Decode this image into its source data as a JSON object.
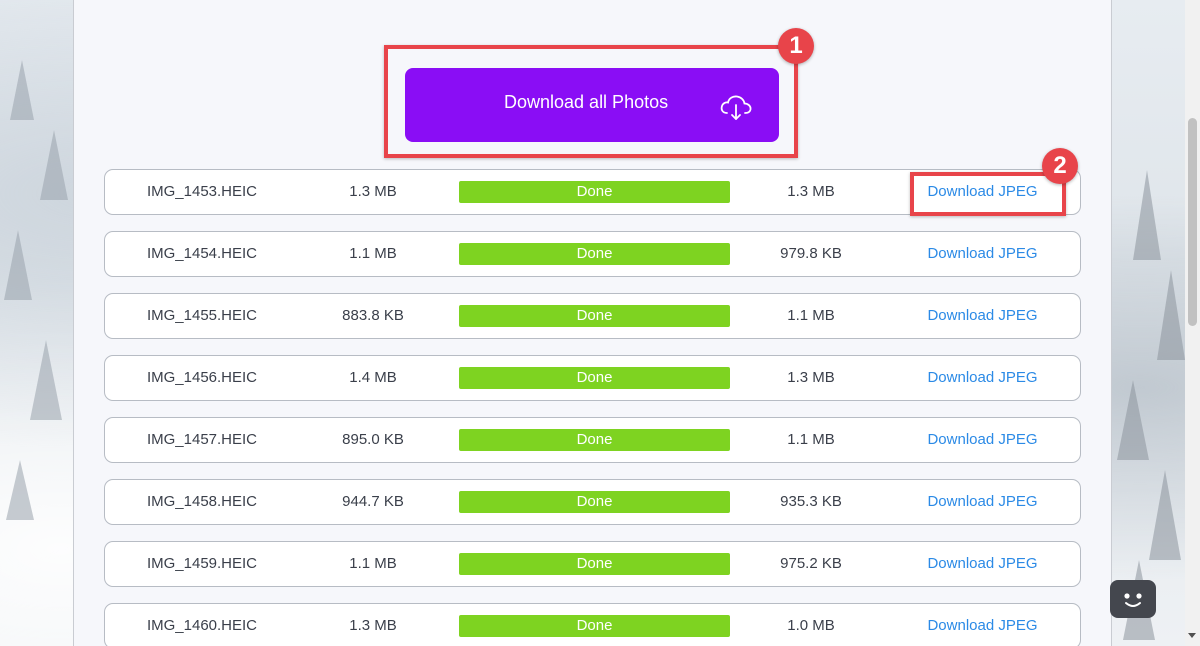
{
  "download_all": {
    "label": "Download all Photos",
    "icon": "cloud-download-icon"
  },
  "callouts": [
    "1",
    "2"
  ],
  "files": [
    {
      "name": "IMG_1453.HEIC",
      "size": "1.3 MB",
      "status": "Done",
      "output_size": "1.3 MB",
      "action": "Download JPEG"
    },
    {
      "name": "IMG_1454.HEIC",
      "size": "1.1 MB",
      "status": "Done",
      "output_size": "979.8 KB",
      "action": "Download JPEG"
    },
    {
      "name": "IMG_1455.HEIC",
      "size": "883.8 KB",
      "status": "Done",
      "output_size": "1.1 MB",
      "action": "Download JPEG"
    },
    {
      "name": "IMG_1456.HEIC",
      "size": "1.4 MB",
      "status": "Done",
      "output_size": "1.3 MB",
      "action": "Download JPEG"
    },
    {
      "name": "IMG_1457.HEIC",
      "size": "895.0 KB",
      "status": "Done",
      "output_size": "1.1 MB",
      "action": "Download JPEG"
    },
    {
      "name": "IMG_1458.HEIC",
      "size": "944.7 KB",
      "status": "Done",
      "output_size": "935.3 KB",
      "action": "Download JPEG"
    },
    {
      "name": "IMG_1459.HEIC",
      "size": "1.1 MB",
      "status": "Done",
      "output_size": "975.2 KB",
      "action": "Download JPEG"
    },
    {
      "name": "IMG_1460.HEIC",
      "size": "1.3 MB",
      "status": "Done",
      "output_size": "1.0 MB",
      "action": "Download JPEG"
    }
  ],
  "colors": {
    "primary_button": "#8a0df5",
    "status_done": "#7ed321",
    "link": "#2b8ae6",
    "callout": "#e8444a"
  },
  "chat_widget": {
    "icon": "chat-face-icon"
  }
}
